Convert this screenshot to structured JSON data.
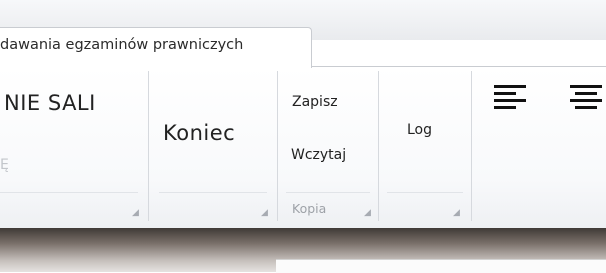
{
  "tab": {
    "label": "dawania egzaminów prawniczych"
  },
  "groups": [
    {
      "name": "sala",
      "big_label": "NIE SALI",
      "sub_label": "Ę",
      "group_label": ""
    },
    {
      "name": "koniec",
      "button_label": "Koniec",
      "group_label": ""
    },
    {
      "name": "kopia",
      "save_label": "Zapisz",
      "load_label": "Wczytaj",
      "group_label": "Kopia"
    },
    {
      "name": "log",
      "button_label": "Log",
      "group_label": ""
    }
  ],
  "alignment": {
    "left": "align-left-icon",
    "center": "align-center-icon"
  },
  "launcher_glyph": "◢"
}
